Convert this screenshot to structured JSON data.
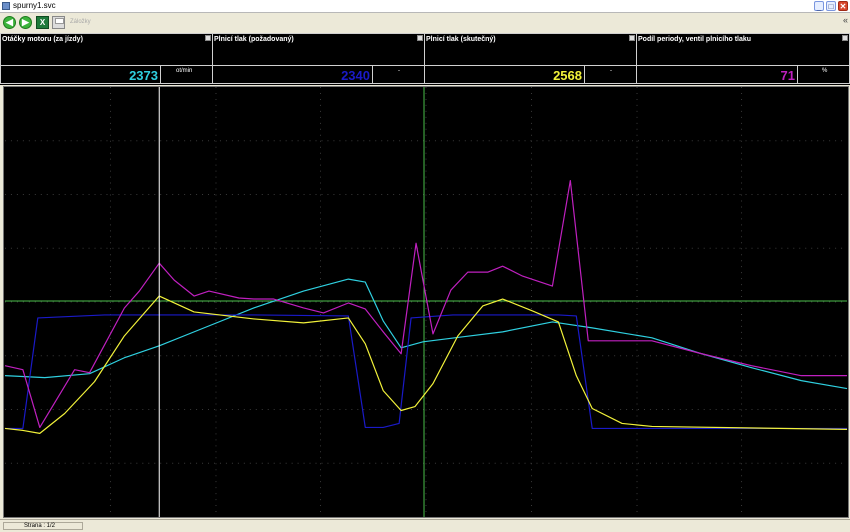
{
  "window": {
    "title": "spurny1.svc",
    "minimize": "_",
    "maximize": "□",
    "close": "✕"
  },
  "toolbar": {
    "zoom_label": "Záložky",
    "chevron": "«"
  },
  "panels": [
    {
      "title": "Otáčky motoru (za jízdy)",
      "value": "2373",
      "unit": "ot/min",
      "color": "#2fd0e0"
    },
    {
      "title": "Plnicí tlak (požadovaný)",
      "value": "2340",
      "unit": "-",
      "color": "#1a1ac8"
    },
    {
      "title": "Plnicí tlak (skutečný)",
      "value": "2568",
      "unit": "-",
      "color": "#f2f23a"
    },
    {
      "title": "Podíl periody, ventil plnicího tlaku",
      "value": "71",
      "unit": "%",
      "color": "#c020c0"
    }
  ],
  "status": {
    "page": "Strana : 1/2"
  },
  "chart_data": {
    "type": "line",
    "title": "",
    "ylim": [
      0,
      432
    ],
    "grid": true,
    "cursor": {
      "x": 155,
      "label": "white"
    },
    "reference": {
      "x": 421,
      "y": 215
    },
    "series": [
      {
        "key": "rpm",
        "color": "#2fd0e0",
        "points": [
          [
            0,
            290
          ],
          [
            40,
            292
          ],
          [
            85,
            288
          ],
          [
            120,
            272
          ],
          [
            155,
            260
          ],
          [
            200,
            242
          ],
          [
            250,
            222
          ],
          [
            300,
            205
          ],
          [
            345,
            193
          ],
          [
            362,
            196
          ],
          [
            380,
            235
          ],
          [
            398,
            262
          ],
          [
            420,
            256
          ],
          [
            460,
            251
          ],
          [
            500,
            246
          ],
          [
            550,
            236
          ],
          [
            590,
            242
          ],
          [
            650,
            252
          ],
          [
            700,
            268
          ],
          [
            750,
            282
          ],
          [
            800,
            295
          ],
          [
            846,
            303
          ]
        ]
      },
      {
        "key": "boost_req",
        "color": "#1a1ac8",
        "points": [
          [
            0,
            343
          ],
          [
            18,
            343
          ],
          [
            33,
            232
          ],
          [
            100,
            229
          ],
          [
            150,
            229
          ],
          [
            250,
            229
          ],
          [
            345,
            230
          ],
          [
            362,
            342
          ],
          [
            380,
            342
          ],
          [
            396,
            338
          ],
          [
            408,
            232
          ],
          [
            450,
            229
          ],
          [
            556,
            229
          ],
          [
            574,
            230
          ],
          [
            590,
            343
          ],
          [
            650,
            343
          ],
          [
            846,
            343
          ]
        ]
      },
      {
        "key": "boost_act",
        "color": "#f2f23a",
        "points": [
          [
            0,
            343
          ],
          [
            18,
            345
          ],
          [
            35,
            348
          ],
          [
            60,
            328
          ],
          [
            90,
            296
          ],
          [
            120,
            250
          ],
          [
            155,
            210
          ],
          [
            190,
            226
          ],
          [
            250,
            233
          ],
          [
            300,
            237
          ],
          [
            345,
            232
          ],
          [
            362,
            258
          ],
          [
            380,
            305
          ],
          [
            398,
            325
          ],
          [
            412,
            321
          ],
          [
            430,
            298
          ],
          [
            455,
            250
          ],
          [
            480,
            220
          ],
          [
            500,
            213
          ],
          [
            530,
            225
          ],
          [
            556,
            236
          ],
          [
            574,
            290
          ],
          [
            590,
            323
          ],
          [
            620,
            338
          ],
          [
            650,
            341
          ],
          [
            846,
            344
          ]
        ]
      },
      {
        "key": "duty",
        "color": "#c020c0",
        "points": [
          [
            0,
            280
          ],
          [
            18,
            284
          ],
          [
            35,
            342
          ],
          [
            70,
            284
          ],
          [
            85,
            287
          ],
          [
            120,
            222
          ],
          [
            135,
            205
          ],
          [
            155,
            177
          ],
          [
            170,
            194
          ],
          [
            190,
            210
          ],
          [
            205,
            205
          ],
          [
            235,
            212
          ],
          [
            250,
            213
          ],
          [
            270,
            213
          ],
          [
            300,
            222
          ],
          [
            320,
            227
          ],
          [
            345,
            217
          ],
          [
            362,
            223
          ],
          [
            380,
            246
          ],
          [
            398,
            268
          ],
          [
            413,
            157
          ],
          [
            430,
            248
          ],
          [
            448,
            204
          ],
          [
            465,
            186
          ],
          [
            485,
            186
          ],
          [
            500,
            180
          ],
          [
            520,
            190
          ],
          [
            550,
            200
          ],
          [
            568,
            94
          ],
          [
            586,
            255
          ],
          [
            650,
            255
          ],
          [
            700,
            268
          ],
          [
            750,
            280
          ],
          [
            800,
            290
          ],
          [
            846,
            290
          ]
        ]
      }
    ]
  }
}
